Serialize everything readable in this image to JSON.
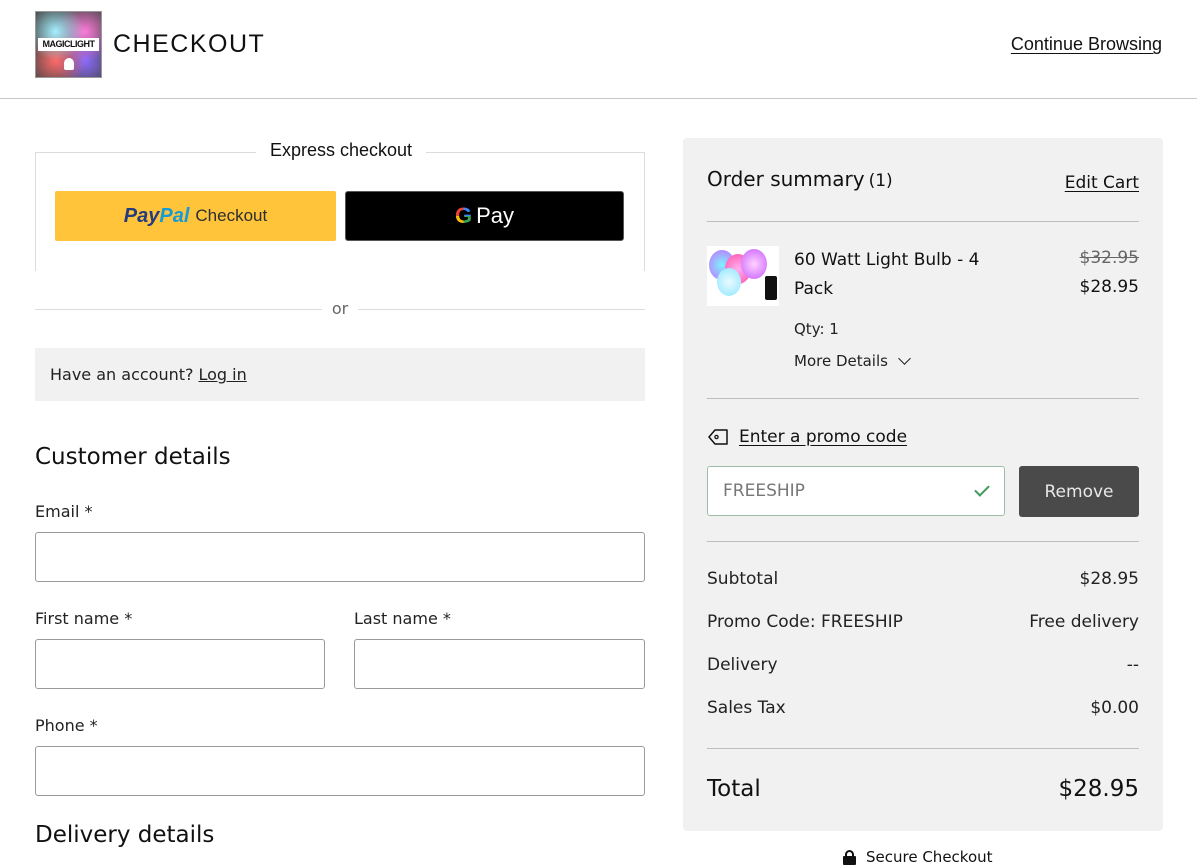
{
  "header": {
    "logo_text": "MAGICLIGHT",
    "title": "CHECKOUT",
    "continue_label": "Continue Browsing"
  },
  "express": {
    "title": "Express checkout",
    "paypal_logo_a": "Pay",
    "paypal_logo_b": "Pal",
    "paypal_label": "Checkout",
    "gpay_g": "G",
    "gpay_label": "Pay"
  },
  "or_text": "or",
  "account": {
    "prompt": "Have an account?",
    "login_label": "Log in"
  },
  "customer": {
    "title": "Customer details",
    "email_label": "Email *",
    "email_value": "",
    "first_name_label": "First name *",
    "first_name_value": "",
    "last_name_label": "Last name *",
    "last_name_value": "",
    "phone_label": "Phone *",
    "phone_value": ""
  },
  "delivery": {
    "title": "Delivery details"
  },
  "summary": {
    "title": "Order summary",
    "count": "(1)",
    "edit_cart_label": "Edit Cart",
    "item": {
      "name": "60 Watt Light Bulb - 4 Pack",
      "old_price": "$32.95",
      "price": "$28.95",
      "qty": "Qty: 1",
      "more_details": "More Details"
    },
    "promo_link": "Enter a promo code",
    "promo_value": "FREESHIP",
    "remove_label": "Remove",
    "lines": [
      {
        "label": "Subtotal",
        "value": "$28.95"
      },
      {
        "label": "Promo Code: FREESHIP",
        "value": "Free delivery"
      },
      {
        "label": "Delivery",
        "value": "--"
      },
      {
        "label": "Sales Tax",
        "value": "$0.00"
      }
    ],
    "total_label": "Total",
    "total_value": "$28.95"
  },
  "secure_label": "Secure Checkout",
  "colors": {
    "paypal": "#ffc439",
    "summary_bg": "#f1f1f1",
    "remove_bg": "#4a4a4a",
    "promo_check": "#3f9a5f"
  }
}
